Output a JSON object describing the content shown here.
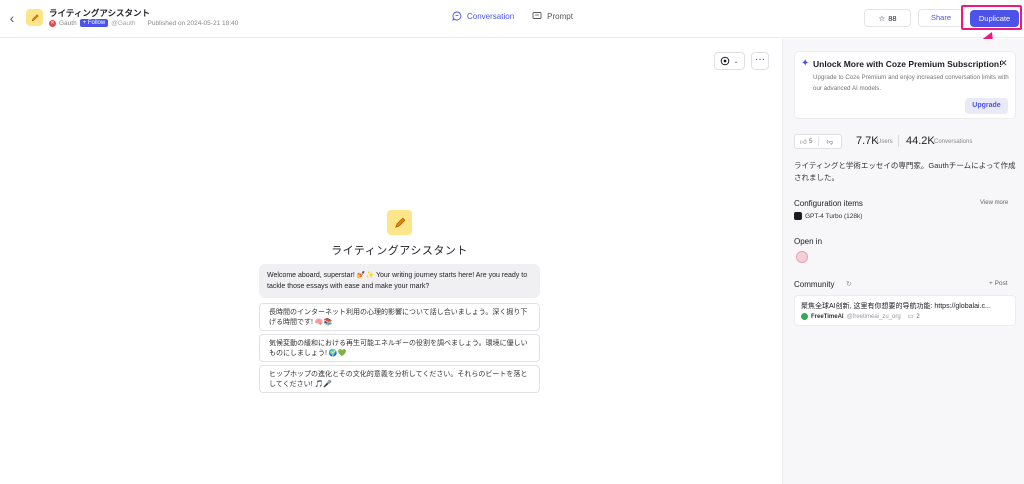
{
  "header": {
    "back_icon": "chevron-left-icon",
    "bot_title": "ライティングアシスタント",
    "author": "Gauth",
    "follow_label": "+ Follow",
    "author_handle": "@Gauth",
    "published": "Published on 2024-05-21 18:40",
    "tabs": [
      {
        "label": "Conversation",
        "icon": "chat-bubble-icon",
        "active": true
      },
      {
        "label": "Prompt",
        "icon": "prompt-icon",
        "active": false
      }
    ],
    "star_count": "88",
    "share_label": "Share",
    "duplicate_label": "Duplicate"
  },
  "chat": {
    "bot_name": "ライティングアシスタント",
    "welcome": "Welcome aboard, superstar! 💅✨ Your writing journey starts here! Are you ready to tackle those essays with ease and make your mark?",
    "suggestions": [
      "長時間のインターネット利用の心理的影響について話し合いましょう。深く掘り下げる時間です! 🧠📚",
      "気候変動の緩和における再生可能エネルギーの役割を調べましょう。環境に優しいものにしましょう! 🌍💚",
      "ヒップホップの進化とその文化的意義を分析してください。それらのビートを落としてください! 🎵🎤"
    ]
  },
  "promo": {
    "title": "Unlock More with Coze Premium Subscription!",
    "text": "Upgrade to Coze Premium and enjoy increased conversation limits with our advanced AI models.",
    "upgrade_label": "Upgrade"
  },
  "stats": {
    "likes": "5",
    "users_value": "7.7K",
    "users_label": "Users",
    "conversations_value": "44.2K",
    "conversations_label": "Conversations"
  },
  "description": "ライティングと学術エッセイの専門家。Gauthチームによって作成されました。",
  "config": {
    "title": "Configuration items",
    "view_more": "View more",
    "model": "GPT-4 Turbo (128k)"
  },
  "open_in": {
    "title": "Open in"
  },
  "community": {
    "title": "Community",
    "post_label": "+ Post",
    "card_text": "聚焦全球AI创新, 这里有你想要的导航功能: https://globalai.c...",
    "card_author": "FreeTimeAI",
    "card_handle": "@freetimeai_zu_org",
    "card_comments": "2"
  },
  "colors": {
    "accent": "#4d53e8",
    "highlight": "#f0187e"
  }
}
